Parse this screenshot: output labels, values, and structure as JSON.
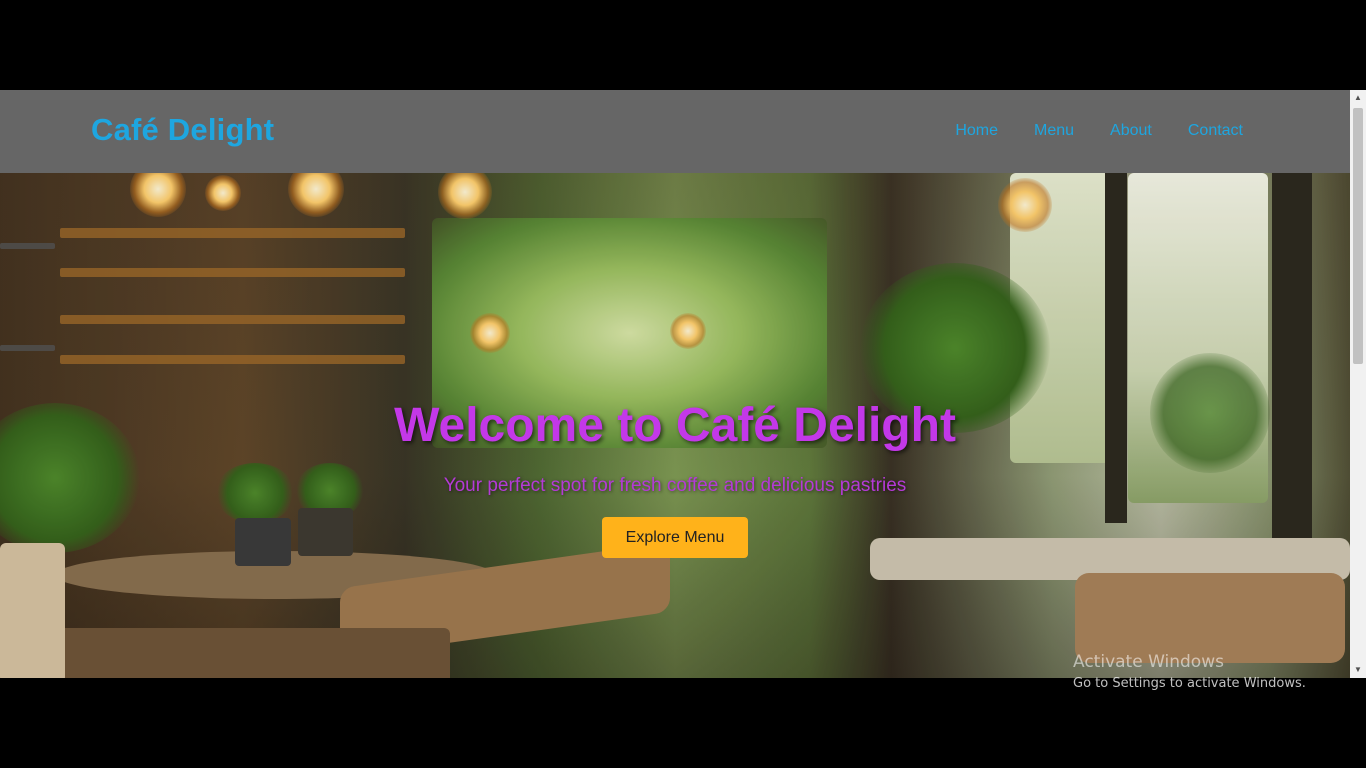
{
  "navbar": {
    "brand": "Café Delight",
    "links": [
      "Home",
      "Menu",
      "About",
      "Contact"
    ]
  },
  "hero": {
    "title": "Welcome to Café Delight",
    "subtitle": "Your perfect spot for fresh coffee and delicious pastries",
    "cta_label": "Explore Menu"
  },
  "watermark": {
    "line1": "Activate Windows",
    "line2": "Go to Settings to activate Windows."
  },
  "colors": {
    "navbar_bg": "#666666",
    "brand": "#1ea6e0",
    "hero_title": "#c338e8",
    "cta_bg": "#ffb21a"
  },
  "scrollbar": {
    "up_icon": "chevron-up-icon",
    "down_icon": "chevron-down-icon"
  }
}
